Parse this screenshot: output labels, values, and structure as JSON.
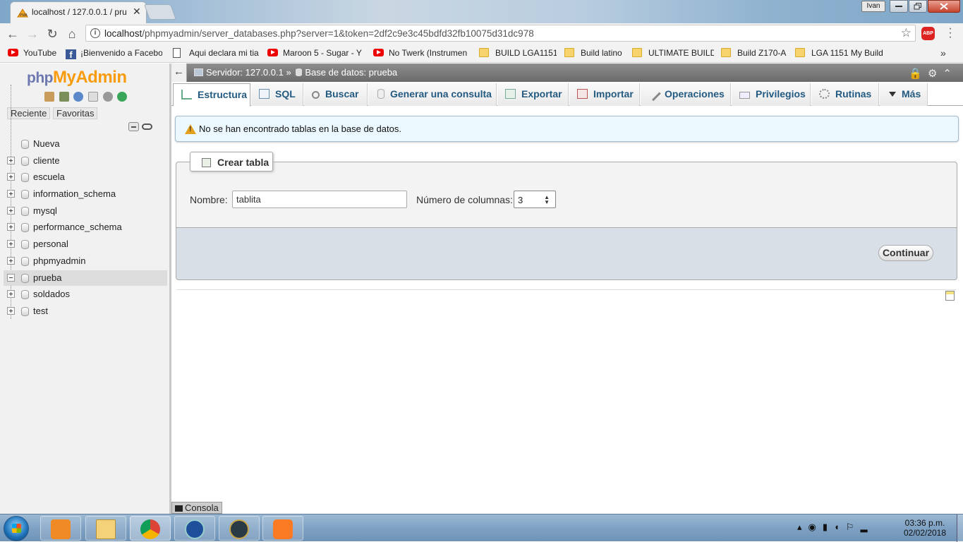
{
  "browser": {
    "tab_title": "localhost / 127.0.0.1 / pru",
    "user_chip": "Ivan",
    "url_host": "localhost",
    "url_path": "/phpmyadmin/server_databases.php?server=1&token=2df2c9e3c45bdfd32fb10075d31dc978",
    "abp_label": "ABP",
    "bookmarks": [
      {
        "label": "YouTube",
        "icon": "youtube-icon"
      },
      {
        "label": "¡Bienvenido a Facebo",
        "icon": "facebook-icon"
      },
      {
        "label": "Aqui declara mi tia",
        "icon": "page-icon"
      },
      {
        "label": "Maroon 5 - Sugar - Y",
        "icon": "youtube-icon"
      },
      {
        "label": "No Twerk (Instrumen",
        "icon": "youtube-icon"
      },
      {
        "label": "BUILD LGA1151",
        "icon": "folder-icon"
      },
      {
        "label": "Build latino",
        "icon": "folder-icon"
      },
      {
        "label": "ULTIMATE BUILD",
        "icon": "folder-icon"
      },
      {
        "label": "Build Z170-A",
        "icon": "folder-icon"
      },
      {
        "label": "LGA 1151 My Build",
        "icon": "folder-icon"
      }
    ],
    "more_bookmarks": "»"
  },
  "pma": {
    "logo_php": "php",
    "logo_myadmin": "MyAdmin",
    "btn_recent": "Reciente",
    "btn_favorites": "Favoritas",
    "tree": {
      "new_label": "Nueva",
      "databases": [
        "cliente",
        "escuela",
        "information_schema",
        "mysql",
        "performance_schema",
        "personal",
        "phpmyadmin",
        "prueba",
        "soldados",
        "test"
      ],
      "selected": "prueba"
    },
    "breadcrumb": {
      "server": "Servidor: 127.0.0.1",
      "sep": "»",
      "database": "Base de datos: prueba"
    },
    "tabs": [
      {
        "label": "Estructura",
        "icon": "structure-icon",
        "active": true
      },
      {
        "label": "SQL",
        "icon": "sql-icon"
      },
      {
        "label": "Buscar",
        "icon": "search-icon"
      },
      {
        "label": "Generar una consulta",
        "icon": "query-icon"
      },
      {
        "label": "Exportar",
        "icon": "export-icon"
      },
      {
        "label": "Importar",
        "icon": "import-icon"
      },
      {
        "label": "Operaciones",
        "icon": "wrench-icon"
      },
      {
        "label": "Privilegios",
        "icon": "privileges-icon"
      },
      {
        "label": "Rutinas",
        "icon": "routines-icon"
      },
      {
        "label": "Más",
        "icon": "chevron-down-icon"
      }
    ],
    "notice": "No se han encontrado tablas en la base de datos.",
    "create_table": {
      "legend": "Crear tabla",
      "name_label": "Nombre:",
      "name_value": "tablita",
      "columns_label": "Número de columnas:",
      "columns_value": "3",
      "submit": "Continuar"
    },
    "console": "Consola"
  },
  "taskbar": {
    "time": "03:36 p.m.",
    "date": "02/02/2018"
  }
}
